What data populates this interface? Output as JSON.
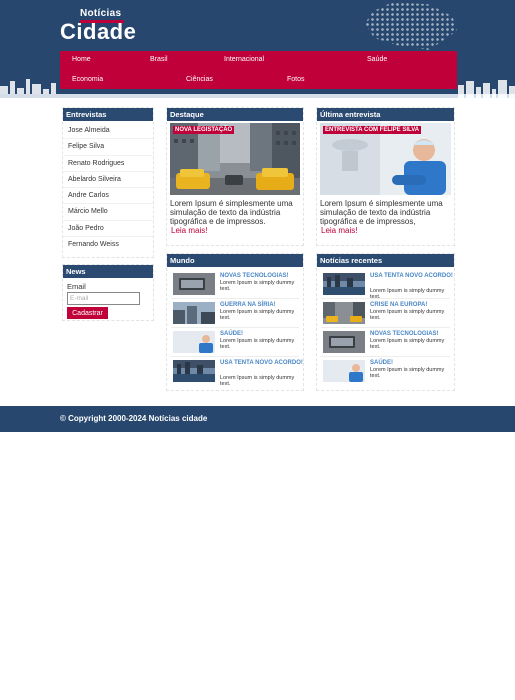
{
  "header": {
    "logo_small": "Notícias",
    "logo_big": "Cidade"
  },
  "nav": {
    "items": [
      "Home",
      "Brasil",
      "Internacional",
      "Saúde",
      "Economia",
      "Ciências",
      "Fotos"
    ]
  },
  "entrevistas": {
    "title": "Entrevistas",
    "items": [
      "Jose Almeida",
      "Felipe Silva",
      "Renato Rodrigues",
      "Abelardo Silveira",
      "Andre Carlos",
      "Márcio Mello",
      "João Pedro",
      "Fernando Weiss"
    ]
  },
  "news": {
    "title": "News",
    "email_label": "Email",
    "email_placeholder": "E-mail",
    "submit_label": "Cadastrar"
  },
  "destaque": {
    "title": "Destaque",
    "tag": "NOVA LEGISTAÇÃO",
    "text": "Lorem Ipsum é simplesmente uma simulação de texto da indústria tipográfica e de impressos.",
    "read_more": "Leia mais!"
  },
  "ultima": {
    "title": "Última entrevista",
    "tag": "ENTREVISTA COM FELIPE SILVA",
    "text": "Lorem Ipsum é simplesmente uma simulação de texto da indústria tipográfica e de impressos,",
    "read_more": "Leia mais!"
  },
  "mundo": {
    "title": "Mundo",
    "items": [
      {
        "title": "NOVAS TECNOLOGIAS!",
        "text": "Lorem Ipsum is simply dummy text."
      },
      {
        "title": "GUERRA NA SÍRIA!",
        "text": "Lorem Ipsum is simply dummy text."
      },
      {
        "title": "SAÚDE!",
        "text": "Lorem Ipsum is simply dummy text."
      },
      {
        "title": "USA TENTA NOVO ACORDO!",
        "text": "Lorem Ipsum is simply dummy text."
      }
    ]
  },
  "recentes": {
    "title": "Notícias recentes",
    "items": [
      {
        "title": "USA TENTA NOVO ACORDO!",
        "text": "Lorem Ipsum is simply dummy text."
      },
      {
        "title": "CRISE NA EUROPA!",
        "text": "Lorem Ipsum is simply dummy text."
      },
      {
        "title": "NOVAS TECNOLOGIAS!",
        "text": "Lorem Ipsum is simply dummy text."
      },
      {
        "title": "SAÚDE!",
        "text": "Lorem Ipsum is simply dummy text."
      }
    ]
  },
  "footer": {
    "copyright": "© Copyright 2000-2024 Notícias cidade"
  },
  "colors": {
    "brand_blue": "#27476e",
    "brand_red": "#c00038",
    "link_blue": "#4a86c5"
  }
}
